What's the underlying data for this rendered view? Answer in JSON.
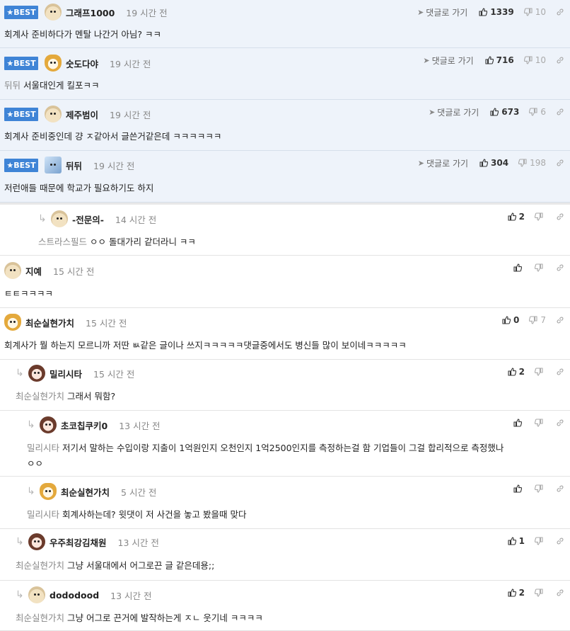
{
  "best_label": "BEST",
  "goto_label": "댓글로 가기",
  "comments": [
    {
      "best": true,
      "avatar": "puppy",
      "nick": "그래프1000",
      "time": "19 시간 전",
      "body": "회계사 준비하다가 멘탈 나간거 아님? ㅋㅋ",
      "up": "1339",
      "down": "10"
    },
    {
      "best": true,
      "avatar": "fox",
      "nick": "숫도다야",
      "time": "19 시간 전",
      "mention": "뒤뒤",
      "body": "서울대인게 킬포ㅋㅋ",
      "up": "716",
      "down": "10"
    },
    {
      "best": true,
      "avatar": "puppy",
      "nick": "제주범이",
      "time": "19 시간 전",
      "body": "회계사 준비중인데 걍 ㅈ같아서 글쓴거같은데 ㅋㅋㅋㅋㅋㅋ",
      "up": "673",
      "down": "6"
    },
    {
      "best": true,
      "avatar": "ice",
      "nick": "뒤뒤",
      "time": "19 시간 전",
      "body": "저런애들 때문에 학교가 필요하기도 하지",
      "up": "304",
      "down": "198"
    },
    {
      "best": false,
      "avatar": "puppy",
      "nick": "-전문의-",
      "time": "14 시간 전",
      "mention": "스트라스필드",
      "body": "ㅇㅇ 돌대가리 같더라니 ㅋㅋ",
      "up": "2",
      "down": ""
    },
    {
      "best": false,
      "avatar": "puppy",
      "nick": "지예",
      "time": "15 시간 전",
      "body": "ㅌㅌㅋㅋㅋㅋ",
      "up": "",
      "down": ""
    },
    {
      "best": false,
      "avatar": "fox",
      "nick": "최순실현가치",
      "time": "15 시간 전",
      "body": "회계사가 뭘 하는지 모르니까 저딴 ㅄ같은 글이나 쓰지ㅋㅋㅋㅋㅋ댓글중에서도 병신들 많이 보이네ㅋㅋㅋㅋㅋ",
      "up": "0",
      "down": "7"
    },
    {
      "best": false,
      "avatar": "doll",
      "nick": "밀리시타",
      "time": "15 시간 전",
      "mention": "최순실현가치",
      "body": "그래서 뭐함?",
      "up": "2",
      "down": ""
    },
    {
      "best": false,
      "avatar": "doll",
      "nick": "초코칩쿠키0",
      "time": "13 시간 전",
      "mention": "밀리시타",
      "body": "저기서 말하는 수입이랑 지출이 1억원인지 오천인지 1억2500인지를 측정하는걸 함 기업들이 그걸 합리적으로 측정했나",
      "body2": "ㅇㅇ",
      "up": "",
      "down": ""
    },
    {
      "best": false,
      "avatar": "fox",
      "nick": "최순실현가치",
      "time": "5 시간 전",
      "mention": "밀리시타",
      "body": "회계사하는데? 윗댓이 저 사건을 놓고 봤을때 맞다",
      "up": "",
      "down": ""
    },
    {
      "best": false,
      "avatar": "doll",
      "nick": "우주최강김채원",
      "time": "13 시간 전",
      "mention": "최순실현가치",
      "body": "그냥 서울대에서 어그로끈 글 같은데용;;",
      "up": "1",
      "down": ""
    },
    {
      "best": false,
      "avatar": "puppy",
      "nick": "dododood",
      "time": "13 시간 전",
      "mention": "최순실현가치",
      "body": "그냥 어그로 끈거에 발작하는게 ㅈㄴ 웃기네 ㅋㅋㅋㅋ",
      "up": "2",
      "down": ""
    }
  ]
}
